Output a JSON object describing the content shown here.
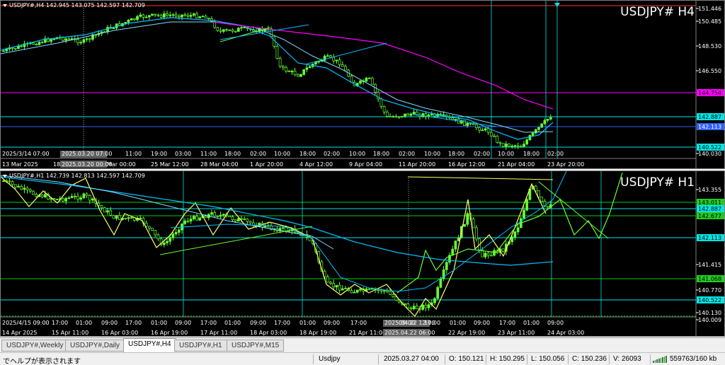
{
  "charts": [
    {
      "id": "top",
      "header": "USDJPY#,H4  142.945 143.075 142.597 142.709",
      "name": "USDJPY# H4",
      "price_labels": [
        {
          "text": "151.446",
          "kind": "axis"
        },
        {
          "text": "150.485",
          "kind": "axis"
        },
        {
          "text": "148.530",
          "kind": "axis"
        },
        {
          "text": "146.550",
          "kind": "axis"
        },
        {
          "text": "144.754",
          "kind": "magenta"
        },
        {
          "text": "142.887",
          "kind": "cyanbox"
        },
        {
          "text": "142.113",
          "kind": "bluebox"
        },
        {
          "text": "140.522",
          "kind": "cyanbox"
        },
        {
          "text": "140.030",
          "kind": "axis"
        }
      ],
      "sub_labels": [
        "2025/3/14 07:00",
        "2025.03.20 07:00",
        "11:00",
        "19:00",
        "03:00",
        "11:00",
        "18:00",
        "02:00",
        "10:00",
        "18:00",
        "02:00",
        "10:00",
        "18:00",
        "02:00",
        "10:00",
        "18:00",
        "02:00",
        "10:00",
        "18:00",
        "02:00"
      ],
      "time_labels": [
        "13 Mar 2025",
        "18",
        "2025.03.20 00:00",
        "Mar 00:00",
        "25 Mar 12:00",
        "28 Mar 04:00",
        "1 Apr 20:00",
        "4 Apr 12:00",
        "9 Apr 04:00",
        "11 Apr 20:00",
        "16 Apr 12:00",
        "21 Apr 04:00",
        "23 Apr 20:00"
      ]
    },
    {
      "id": "bot",
      "header": "USDJPY#,H1  142.739 142.813 142.597 142.709",
      "name": "USDJPY# H1",
      "price_labels": [
        {
          "text": "143.355",
          "kind": "axis"
        },
        {
          "text": "143.011",
          "kind": "greenbox"
        },
        {
          "text": "142.887",
          "kind": "cyanbox"
        },
        {
          "text": "142.677",
          "kind": "greenbox"
        },
        {
          "text": "142.113",
          "kind": "cyanbox"
        },
        {
          "text": "141.415",
          "kind": "axis"
        },
        {
          "text": "141.068",
          "kind": "greenbox"
        },
        {
          "text": "140.770",
          "kind": "axis"
        },
        {
          "text": "140.522",
          "kind": "cyanbox"
        },
        {
          "text": "140.130",
          "kind": "axis"
        },
        {
          "text": "140.009",
          "kind": "axis"
        }
      ],
      "sub_labels": [
        "2025/4/15 09:00",
        "17:00",
        "01:00",
        "09:00",
        "17:00",
        "01:00",
        "09:00",
        "17:00",
        "01:00",
        "09:00",
        "17:00",
        "01:00",
        "09:00",
        "17:00",
        "2025.04.22 12:00",
        "09:00",
        "17:00",
        "01:00",
        "09:00",
        "17:00",
        "01:00",
        "09:00"
      ],
      "time_labels": [
        "14 Apr 2025",
        "15 Apr 11:00",
        "16 Apr 03:00",
        "16 Apr 19:00",
        "17 Apr 11:00",
        "18 Apr 03:00",
        "18 Apr 19:00",
        "21 Apr 11:00",
        "2025.04.22 06:00",
        "22 Apr 19:00",
        "23 Apr 11:00",
        "24 Apr 03:00"
      ]
    }
  ],
  "tabs": [
    {
      "label": "USDJPY#,Weekly",
      "active": false
    },
    {
      "label": "USDJPY#,Daily",
      "active": false
    },
    {
      "label": "USDJPY#,H4",
      "active": true
    },
    {
      "label": "USDJPY#,H1",
      "active": false
    },
    {
      "label": "USDJPY#,M15",
      "active": false
    }
  ],
  "status": {
    "help": "でヘルプが表示されます",
    "profile": "Usdjpy",
    "datetime": "2025.03.27 04:00",
    "open": "O: 150.121",
    "high": "H: 150.295",
    "low": "L: 150.056",
    "close": "C: 150.236",
    "volume": "V: 26093",
    "traffic": "559763/160 kb"
  },
  "colors": {
    "bg": "#000000",
    "bull": "#66ff33",
    "bear": "#000000",
    "ma_fast": "#00bfff",
    "ma_mid": "#7fdcff",
    "ma_slow": "#ff00ff",
    "trend_line": "#66ff33",
    "zigzag": "#ffff66",
    "hline_cyan": "#00e5e5",
    "hline_magenta": "#ff00ff",
    "hline_green": "#00cc00",
    "hline_red": "#ff3030"
  }
}
